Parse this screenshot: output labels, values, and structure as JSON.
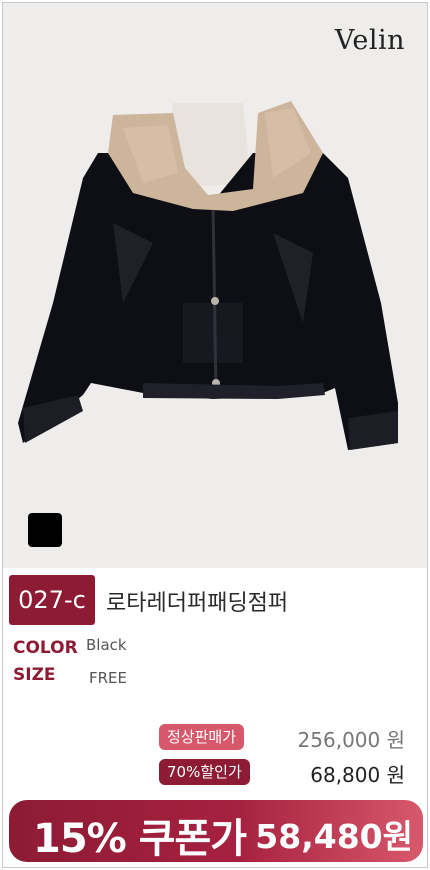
{
  "brand": "Velin",
  "product": {
    "code": "027-c",
    "name": "로타레더퍼패딩점퍼",
    "color_label": "COLOR",
    "color_value": "Black",
    "size_label": "SIZE",
    "size_value": "FREE",
    "swatch_color": "#000000"
  },
  "pricing": {
    "regular_label": "정상판매가",
    "regular_price": "256,000 원",
    "discount_label": "70%할인가",
    "discount_price": "68,800 원",
    "coupon_label": "15% 쿠폰가",
    "coupon_price": "58,480원"
  },
  "colors": {
    "accent": "#8d1b34",
    "regular_pill": "#d8586b",
    "discount_pill": "#8d1b34"
  }
}
